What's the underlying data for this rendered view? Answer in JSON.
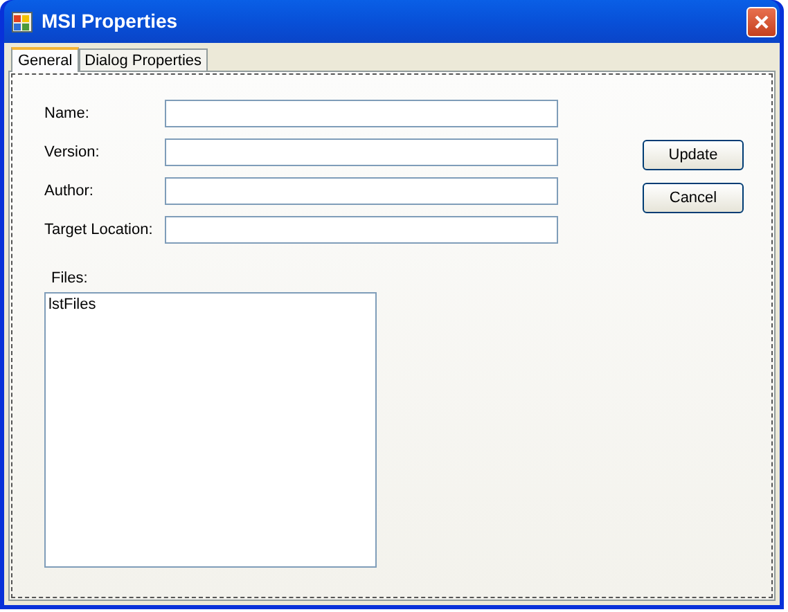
{
  "window": {
    "title": "MSI Properties"
  },
  "tabs": [
    {
      "label": "General",
      "selected": true
    },
    {
      "label": "Dialog Properties",
      "selected": false
    }
  ],
  "fields": [
    {
      "label": "Name:"
    },
    {
      "label": "Version:"
    },
    {
      "label": "Author:"
    },
    {
      "label": "Target Location:"
    }
  ],
  "buttons": [
    "Update",
    "Cancel"
  ],
  "files": {
    "label": "Files:",
    "items": [
      "lstFiles"
    ]
  }
}
